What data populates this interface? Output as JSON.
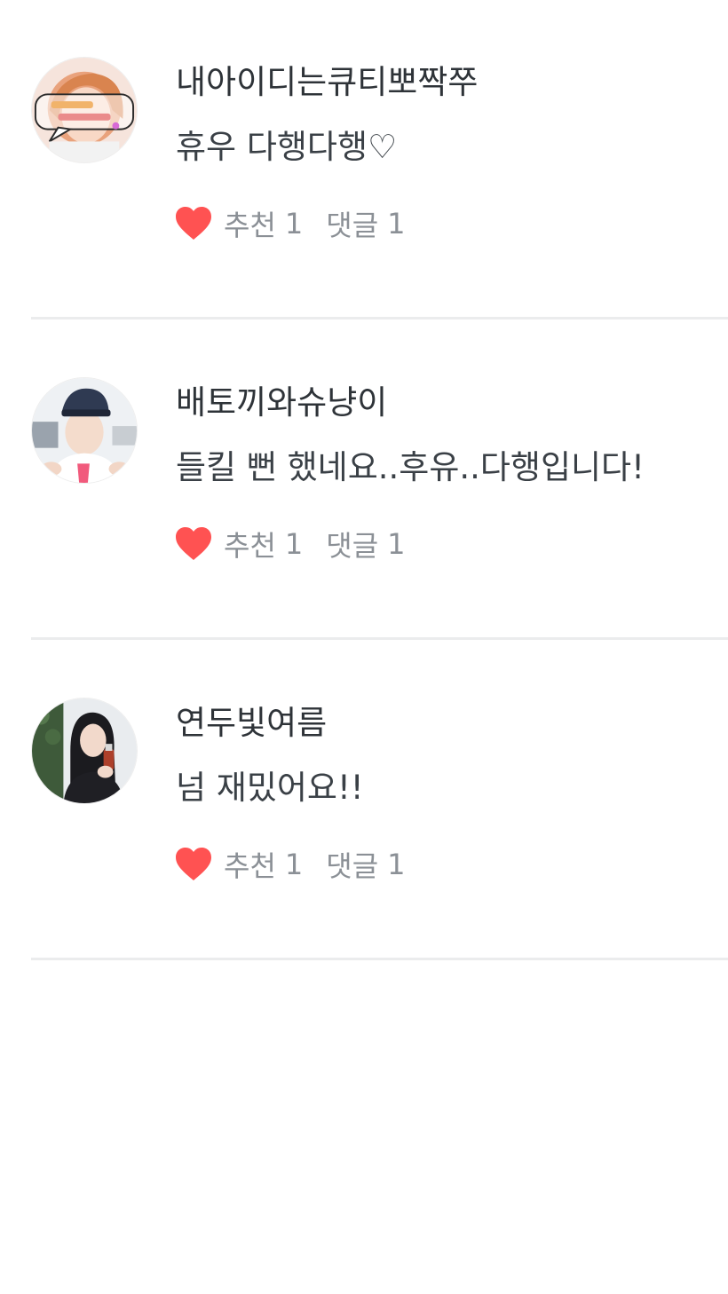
{
  "comments": [
    {
      "nickname": "내아이디는큐티뽀짝쭈",
      "text": "휴우 다행다행♡",
      "recommend_label": "추천",
      "recommend_count": "1",
      "reply_label": "댓글",
      "reply_count": "1",
      "avatar_icon": "avatar-photo"
    },
    {
      "nickname": "배토끼와슈냥이",
      "text": "들킬 뻔 했네요..후유..다행입니다!",
      "recommend_label": "추천",
      "recommend_count": "1",
      "reply_label": "댓글",
      "reply_count": "1",
      "avatar_icon": "avatar-photo"
    },
    {
      "nickname": "연두빛여름",
      "text": "넘 재밌어요!!",
      "recommend_label": "추천",
      "recommend_count": "1",
      "reply_label": "댓글",
      "reply_count": "1",
      "avatar_icon": "avatar-photo"
    }
  ],
  "colors": {
    "heart": "#ff5252",
    "nickname_text": "#2e3338",
    "meta_text": "#8b9096",
    "divider": "#ebeced"
  }
}
